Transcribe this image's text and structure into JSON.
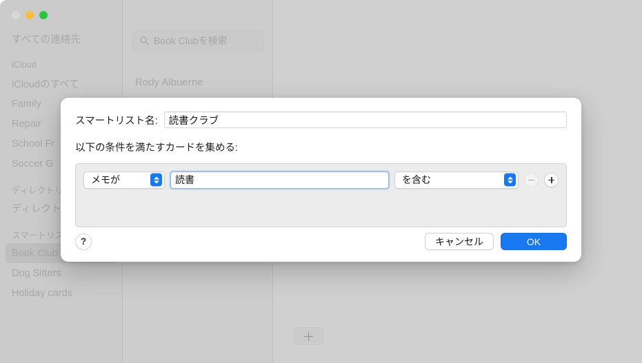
{
  "window": {
    "traffic_lights": [
      {
        "name": "close",
        "color": "#d8d8d8"
      },
      {
        "name": "minimize",
        "color": "#f7bd3d"
      },
      {
        "name": "zoom",
        "color": "#2fc23f"
      }
    ]
  },
  "sidebar": {
    "items": [
      {
        "label": "すべての連絡先",
        "type": "item",
        "selected": false
      },
      {
        "label": "",
        "type": "spacer",
        "selected": false
      },
      {
        "label": "iCloud",
        "type": "header",
        "selected": false
      },
      {
        "label": "iCloudのすべて",
        "type": "item",
        "selected": false
      },
      {
        "label": "Family",
        "type": "item",
        "selected": false
      },
      {
        "label": "Repair",
        "type": "item",
        "selected": false
      },
      {
        "label": "School Fr",
        "type": "item",
        "selected": false
      },
      {
        "label": "Soccer G",
        "type": "item",
        "selected": false
      },
      {
        "label": "",
        "type": "spacer",
        "selected": false
      },
      {
        "label": "ディレクトリ",
        "type": "header",
        "selected": false
      },
      {
        "label": "ディレクト",
        "type": "item",
        "selected": false
      },
      {
        "label": "",
        "type": "spacer",
        "selected": false
      },
      {
        "label": "スマートリス",
        "type": "header",
        "selected": false
      },
      {
        "label": "Book Club",
        "type": "item",
        "selected": true
      },
      {
        "label": "Dog Sitters",
        "type": "item",
        "selected": false
      },
      {
        "label": "Holiday cards",
        "type": "item",
        "selected": false
      }
    ]
  },
  "contacts_column": {
    "search": {
      "icon": "search-icon",
      "placeholder": "Book Clubを検索",
      "value": ""
    },
    "rows": [
      {
        "name": "Rody Albuerne"
      }
    ]
  },
  "detail_pane": {
    "add_card_button": {
      "icon": "plus-icon",
      "label": ""
    }
  },
  "sheet": {
    "name_field": {
      "label": "スマートリスト名:",
      "value": "読書クラブ",
      "placeholder": ""
    },
    "criteria_caption": "以下の条件を満たすカードを集める:",
    "criteria_rows": [
      {
        "field_popup": {
          "value": "メモが",
          "icon": "chevron-updown-icon"
        },
        "value_input": {
          "value": "読書",
          "placeholder": "",
          "focused": true
        },
        "compare_popup": {
          "value": "を含む",
          "icon": "chevron-updown-icon"
        },
        "remove_button": {
          "icon": "minus-icon",
          "enabled": false
        },
        "add_button": {
          "icon": "plus-icon",
          "enabled": true
        }
      }
    ],
    "help_button": {
      "label": "?",
      "icon": "question-mark-icon"
    },
    "cancel_button": {
      "label": "キャンセル"
    },
    "ok_button": {
      "label": "OK"
    }
  },
  "colors": {
    "accent": "#1878f0",
    "focus_ring": "#8cb8ec",
    "traffic_yellow": "#f7bd3d",
    "traffic_green": "#2fc23f",
    "sheet_background": "#ffffff",
    "window_background": "#cfcfcf"
  }
}
